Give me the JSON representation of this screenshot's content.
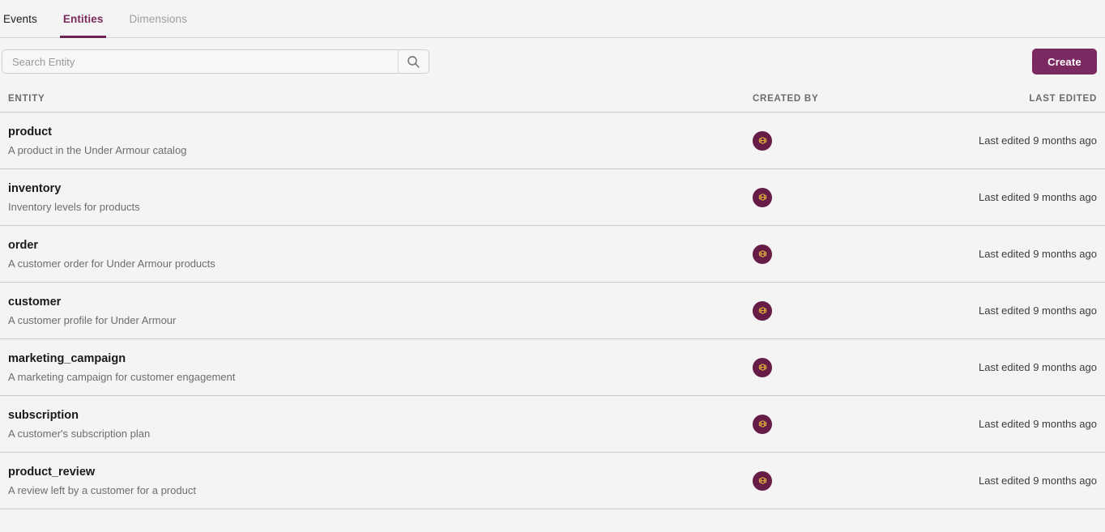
{
  "tabs": [
    {
      "label": "Events",
      "name": "tab-events",
      "active": false
    },
    {
      "label": "Entities",
      "name": "tab-entities",
      "active": true
    },
    {
      "label": "Dimensions",
      "name": "tab-dimensions",
      "active": false
    }
  ],
  "toolbar": {
    "search_placeholder": "Search Entity",
    "search_value": "",
    "search_icon": "search-icon",
    "create_label": "Create"
  },
  "table": {
    "headers": {
      "entity": "ENTITY",
      "created_by": "CREATED BY",
      "last_edited": "LAST EDITED"
    },
    "rows": [
      {
        "name": "product",
        "description": "A product in the Under Armour catalog",
        "created_by_avatar": "under-armour-logo-avatar",
        "last_edited": "Last edited 9 months ago"
      },
      {
        "name": "inventory",
        "description": "Inventory levels for products",
        "created_by_avatar": "under-armour-logo-avatar",
        "last_edited": "Last edited 9 months ago"
      },
      {
        "name": "order",
        "description": "A customer order for Under Armour products",
        "created_by_avatar": "under-armour-logo-avatar",
        "last_edited": "Last edited 9 months ago"
      },
      {
        "name": "customer",
        "description": "A customer profile for Under Armour",
        "created_by_avatar": "under-armour-logo-avatar",
        "last_edited": "Last edited 9 months ago"
      },
      {
        "name": "marketing_campaign",
        "description": "A marketing campaign for customer engagement",
        "created_by_avatar": "under-armour-logo-avatar",
        "last_edited": "Last edited 9 months ago"
      },
      {
        "name": "subscription",
        "description": "A customer's subscription plan",
        "created_by_avatar": "under-armour-logo-avatar",
        "last_edited": "Last edited 9 months ago"
      },
      {
        "name": "product_review",
        "description": "A review left by a customer for a product",
        "created_by_avatar": "under-armour-logo-avatar",
        "last_edited": "Last edited 9 months ago"
      }
    ]
  },
  "colors": {
    "accent": "#7b2a61",
    "accent_dark": "#661c47",
    "page_bg": "#f4f4f4",
    "divider": "#c9c9c9",
    "avatar_glyph": "#d8a93a"
  }
}
